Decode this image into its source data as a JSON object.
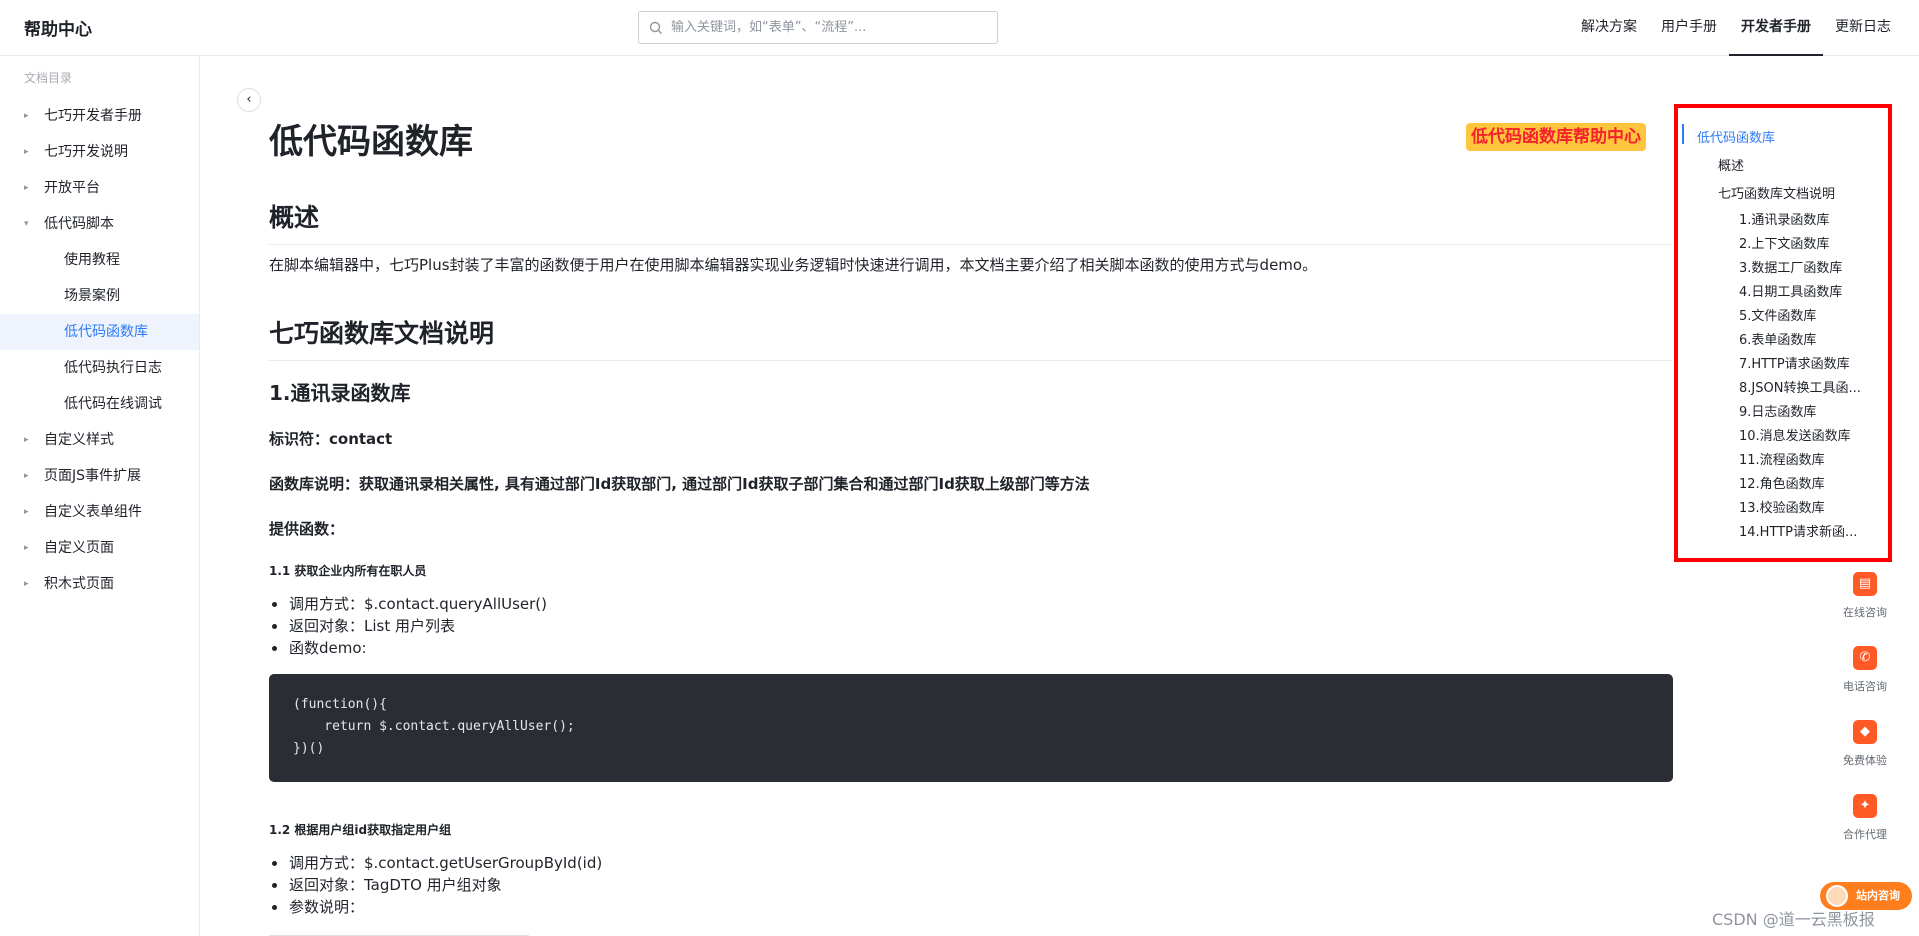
{
  "header": {
    "brand": "帮助中心",
    "search_placeholder": "输入关键词，如“表单”、“流程”...",
    "nav": [
      "解决方案",
      "用户手册",
      "开发者手册",
      "更新日志"
    ],
    "active_nav": "开发者手册"
  },
  "sidebar": {
    "caption": "文档目录",
    "items": [
      {
        "label": "七巧开发者手册"
      },
      {
        "label": "七巧开发说明"
      },
      {
        "label": "开放平台"
      },
      {
        "label": "低代码脚本"
      },
      {
        "label": "使用教程"
      },
      {
        "label": "场景案例"
      },
      {
        "label": "低代码函数库"
      },
      {
        "label": "低代码执行日志"
      },
      {
        "label": "低代码在线调试"
      },
      {
        "label": "自定义样式"
      },
      {
        "label": "页面JS事件扩展"
      },
      {
        "label": "自定义表单组件"
      },
      {
        "label": "自定义页面"
      },
      {
        "label": "积木式页面"
      }
    ],
    "active_item": "低代码函数库"
  },
  "main": {
    "title": "低代码函数库",
    "highlight_badge": "低代码函数库帮助中心",
    "overview_heading": "概述",
    "overview_text": "在脚本编辑器中，七巧Plus封装了丰富的函数便于用户在使用脚本编辑器实现业务逻辑时快速进行调用，本文档主要介绍了相关脚本函数的使用方式与demo。",
    "doc_heading": "七巧函数库文档说明",
    "section1_heading": "1.通讯录函数库",
    "identifier": "标识符：contact",
    "library_desc": "函数库说明：获取通讯录相关属性, 具有通过部门Id获取部门, 通过部门Id获取子部门集合和通过部门Id获取上级部门等方法",
    "provided_functions": "提供函数：",
    "fn1_heading": "1.1 获取企业内所有在职人员",
    "fn1_bullets": [
      "调用方式：$.contact.queryAllUser()",
      "返回对象：List 用户列表",
      "函数demo:"
    ],
    "fn1_code": "(function(){\n    return $.contact.queryAllUser();\n})()",
    "fn2_heading": "1.2 根据用户组id获取指定用户组",
    "fn2_bullets": [
      "调用方式：$.contact.getUserGroupById(id)",
      "返回对象：TagDTO 用户组对象",
      "参数说明："
    ]
  },
  "toc": {
    "items": [
      {
        "label": "低代码函数库"
      },
      {
        "label": "概述"
      },
      {
        "label": "七巧函数库文档说明"
      },
      {
        "label": "1.通讯录函数库"
      },
      {
        "label": "2.上下文函数库"
      },
      {
        "label": "3.数据工厂函数库"
      },
      {
        "label": "4.日期工具函数库"
      },
      {
        "label": "5.文件函数库"
      },
      {
        "label": "6.表单函数库"
      },
      {
        "label": "7.HTTP请求函数库"
      },
      {
        "label": "8.JSON转换工具函..."
      },
      {
        "label": "9.日志函数库"
      },
      {
        "label": "10.消息发送函数库"
      },
      {
        "label": "11.流程函数库"
      },
      {
        "label": "12.角色函数库"
      },
      {
        "label": "13.校验函数库"
      },
      {
        "label": "14.HTTP请求新函..."
      }
    ],
    "active_item": "低代码函数库"
  },
  "float_tools": [
    {
      "label": "在线咨询",
      "icon": "chat-icon"
    },
    {
      "label": "电话咨询",
      "icon": "phone-icon"
    },
    {
      "label": "免费体验",
      "icon": "tag-icon"
    },
    {
      "label": "合作代理",
      "icon": "handshake-icon"
    }
  ],
  "consult_pill": "站内咨询",
  "watermark": "CSDN @道一云黑板报",
  "colors": {
    "accent": "#2e7cf6",
    "highlight_bg": "#ffc53d",
    "highlight_text": "#f5222d",
    "annotation_box": "#ff0000",
    "tool_orange": "#ff5a26"
  }
}
